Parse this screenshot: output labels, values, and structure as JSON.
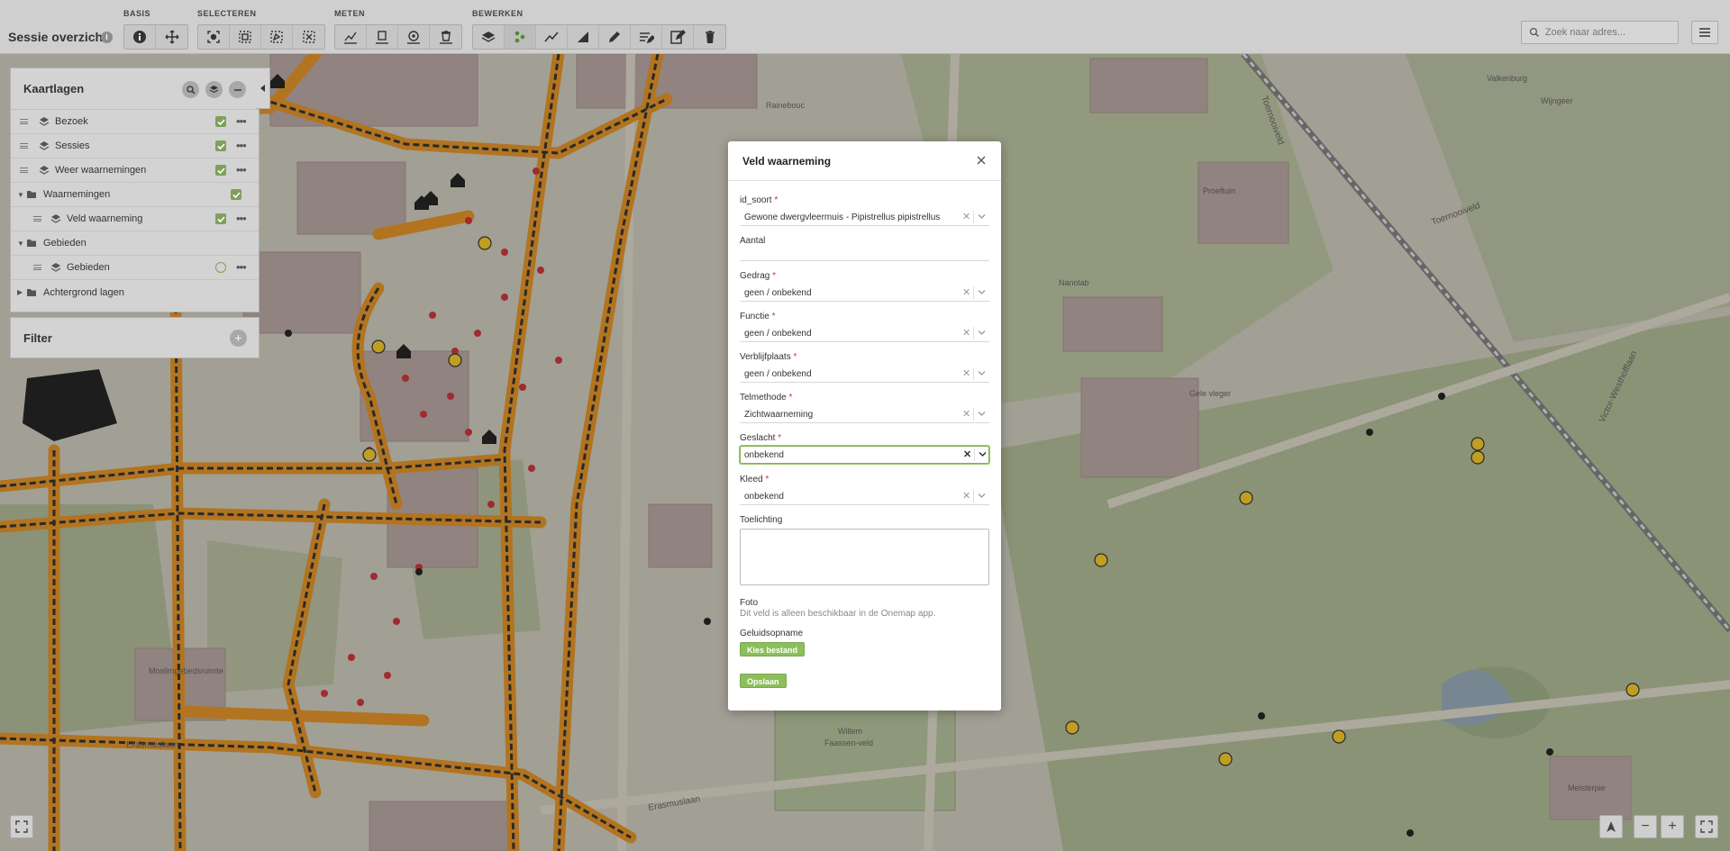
{
  "header": {
    "title": "Sessie overzicht",
    "info_glyph": "i",
    "groups": [
      {
        "label": "BASIS",
        "icons": [
          "info-icon",
          "pan-icon"
        ]
      },
      {
        "label": "SELECTEREN",
        "icons": [
          "select-point-icon",
          "select-box-icon",
          "select-polygon-icon",
          "select-clear-icon"
        ]
      },
      {
        "label": "METEN",
        "icons": [
          "measure-line-icon",
          "measure-area-icon",
          "measure-circle-icon",
          "measure-delete-icon"
        ]
      },
      {
        "label": "BEWERKEN",
        "icons": [
          "layers-edit-icon",
          "edit-points-icon",
          "draw-line-icon",
          "draw-polygon-icon",
          "draw-pencil-icon",
          "edit-attributes-icon",
          "edit-form-icon",
          "delete-icon"
        ]
      }
    ],
    "search_placeholder": "Zoek naar adres...",
    "menu_icon": "hamburger-icon"
  },
  "layers_panel": {
    "title": "Kaartlagen",
    "layers": [
      {
        "label": "Bezoek",
        "type": "layer",
        "level": 0,
        "state": "checked"
      },
      {
        "label": "Sessies",
        "type": "layer",
        "level": 0,
        "state": "checked"
      },
      {
        "label": "Weer waarnemingen",
        "type": "layer",
        "level": 0,
        "state": "checked"
      },
      {
        "label": "Waarnemingen",
        "type": "folder",
        "level": 0,
        "state": "checked"
      },
      {
        "label": "Veld waarneming",
        "type": "layer",
        "level": 1,
        "state": "checked"
      },
      {
        "label": "Gebieden",
        "type": "folder",
        "level": 0,
        "state": "none"
      },
      {
        "label": "Gebieden",
        "type": "layer",
        "level": 1,
        "state": "radio"
      },
      {
        "label": "Achtergrond lagen",
        "type": "folder",
        "level": 0,
        "state": "none"
      }
    ]
  },
  "filter_panel": {
    "title": "Filter",
    "add_glyph": "+"
  },
  "map_controls": {
    "zoom_out": "−",
    "zoom_in": "+"
  },
  "modal": {
    "title": "Veld waarneming",
    "fields": {
      "id_soort": {
        "label": "id_soort",
        "value": "Gewone dwergvleermuis - Pipistrellus pipistrellus"
      },
      "aantal": {
        "label": "Aantal",
        "value": ""
      },
      "gedrag": {
        "label": "Gedrag",
        "value": "geen / onbekend"
      },
      "functie": {
        "label": "Functie",
        "value": "geen / onbekend"
      },
      "verblijfplaats": {
        "label": "Verblijfplaats",
        "value": "geen / onbekend"
      },
      "telmethode": {
        "label": "Telmethode",
        "value": "Zichtwaarneming"
      },
      "geslacht": {
        "label": "Geslacht",
        "value": "onbekend"
      },
      "kleed": {
        "label": "Kleed",
        "value": "onbekend"
      },
      "toelichting": {
        "label": "Toelichting",
        "value": ""
      },
      "foto": {
        "label": "Foto",
        "note": "Dit veld is alleen beschikbaar in de Onemap app."
      },
      "geluidsopname": {
        "label": "Geluidsopname",
        "button": "Kies bestand"
      }
    },
    "required_marker": "*",
    "clear_glyph": "✕",
    "save_button": "Opslaan"
  }
}
